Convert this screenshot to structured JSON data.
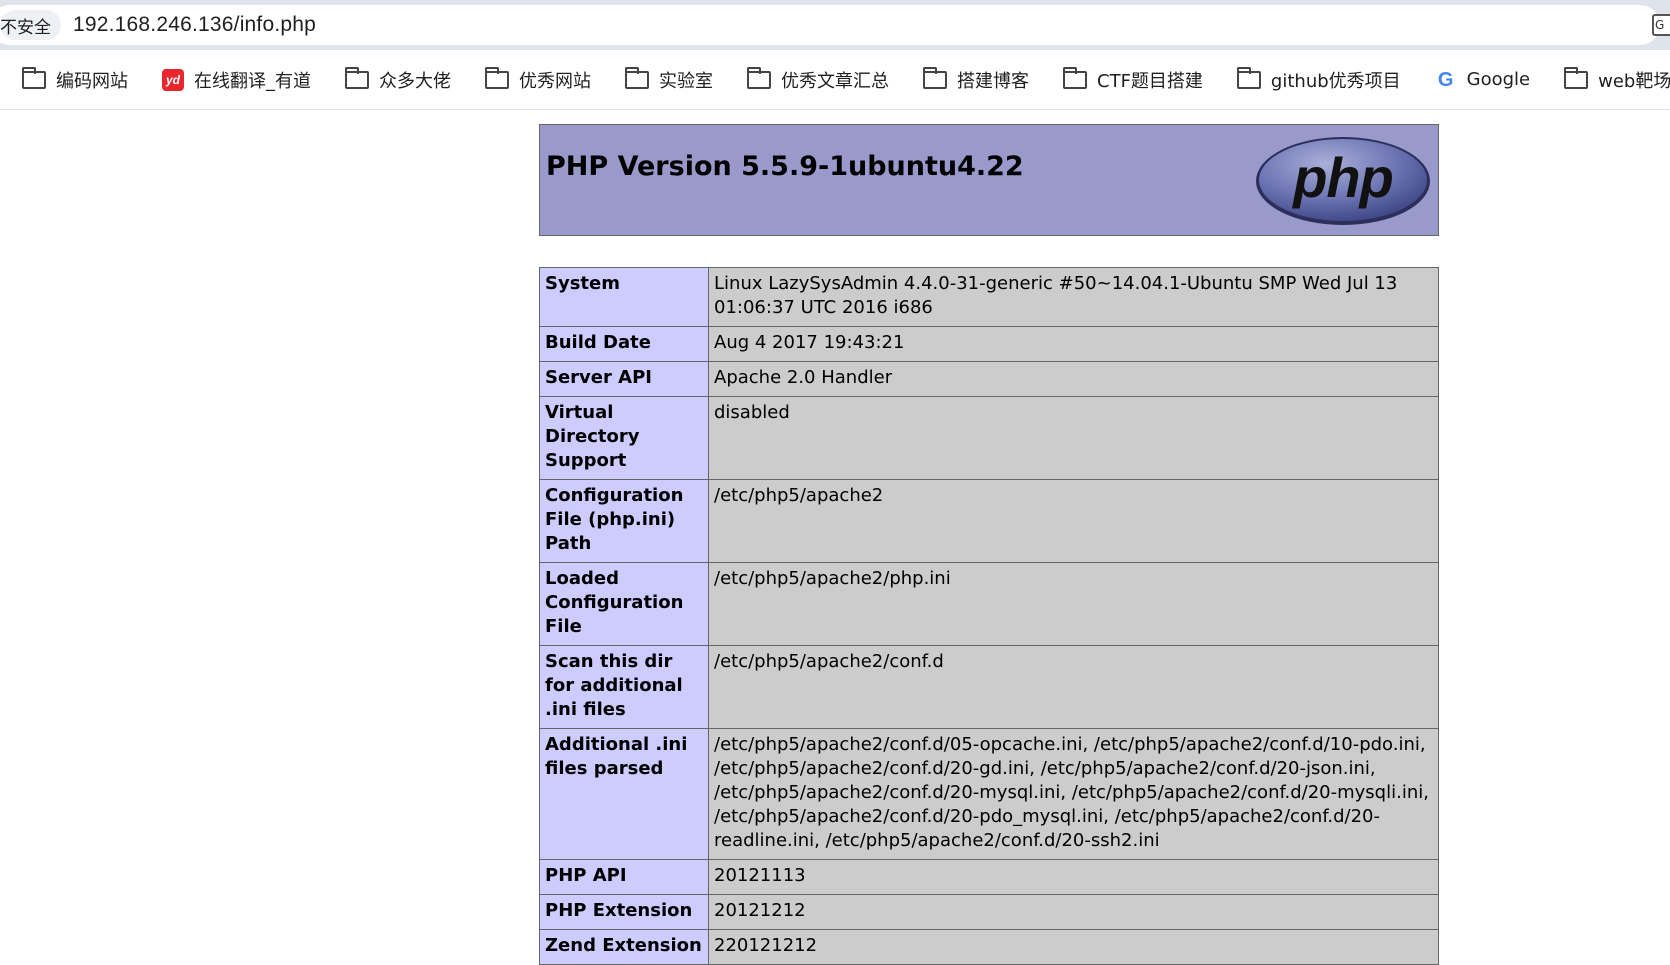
{
  "browser": {
    "security_label": "不安全",
    "url": "192.168.246.136/info.php"
  },
  "bookmarks": [
    {
      "label": "编码网站",
      "icon": "folder-icon"
    },
    {
      "label": "在线翻译_有道",
      "icon": "youdao-icon"
    },
    {
      "label": "众多大佬",
      "icon": "folder-icon"
    },
    {
      "label": "优秀网站",
      "icon": "folder-icon"
    },
    {
      "label": "实验室",
      "icon": "folder-icon"
    },
    {
      "label": "优秀文章汇总",
      "icon": "folder-icon"
    },
    {
      "label": "搭建博客",
      "icon": "folder-icon"
    },
    {
      "label": "CTF题目搭建",
      "icon": "folder-icon"
    },
    {
      "label": "github优秀项目",
      "icon": "folder-icon"
    },
    {
      "label": "Google",
      "icon": "google-icon"
    },
    {
      "label": "web靶场",
      "icon": "folder-icon"
    }
  ],
  "phpinfo": {
    "title": "PHP Version 5.5.9-1ubuntu4.22",
    "logo_text": "php",
    "rows": [
      {
        "key": "System",
        "value": "Linux LazySysAdmin 4.4.0-31-generic #50~14.04.1-Ubuntu SMP Wed Jul 13 01:06:37 UTC 2016 i686"
      },
      {
        "key": "Build Date",
        "value": "Aug 4 2017 19:43:21"
      },
      {
        "key": "Server API",
        "value": "Apache 2.0 Handler"
      },
      {
        "key": "Virtual Directory Support",
        "value": "disabled"
      },
      {
        "key": "Configuration File (php.ini) Path",
        "value": "/etc/php5/apache2"
      },
      {
        "key": "Loaded Configuration File",
        "value": "/etc/php5/apache2/php.ini"
      },
      {
        "key": "Scan this dir for additional .ini files",
        "value": "/etc/php5/apache2/conf.d"
      },
      {
        "key": "Additional .ini files parsed",
        "value": "/etc/php5/apache2/conf.d/05-opcache.ini, /etc/php5/apache2/conf.d/10-pdo.ini, /etc/php5/apache2/conf.d/20-gd.ini, /etc/php5/apache2/conf.d/20-json.ini, /etc/php5/apache2/conf.d/20-mysql.ini, /etc/php5/apache2/conf.d/20-mysqli.ini, /etc/php5/apache2/conf.d/20-pdo_mysql.ini, /etc/php5/apache2/conf.d/20-readline.ini, /etc/php5/apache2/conf.d/20-ssh2.ini"
      },
      {
        "key": "PHP API",
        "value": "20121113"
      },
      {
        "key": "PHP Extension",
        "value": "20121212"
      },
      {
        "key": "Zend Extension",
        "value": "220121212"
      }
    ]
  },
  "colors": {
    "header_bg": "#9999cc",
    "key_cell_bg": "#ccccff",
    "value_cell_bg": "#cccccc",
    "border": "#666666"
  }
}
